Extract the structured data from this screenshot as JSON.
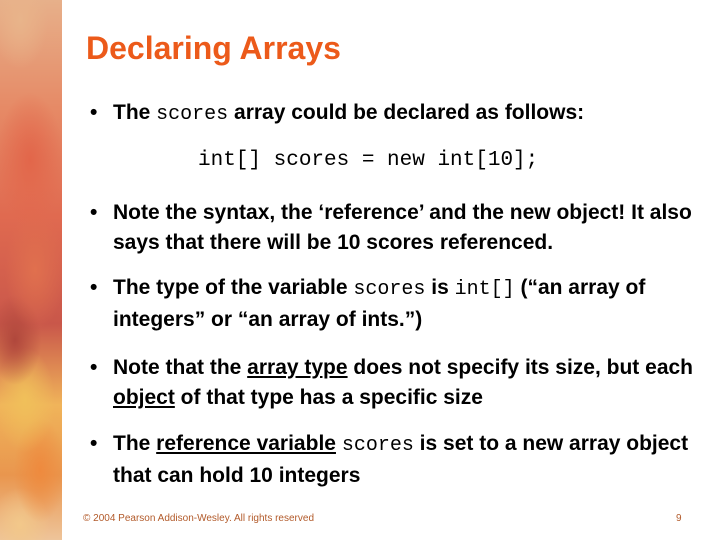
{
  "slide": {
    "title": "Declaring Arrays",
    "colors": {
      "title": "#ec5a1a",
      "footer": "#b25a2a",
      "text": "#000000"
    },
    "bullet_glyph": "•",
    "bullets": [
      {
        "parts": [
          "The ",
          "scores",
          " array could be declared as follows:"
        ]
      },
      {
        "parts": [
          "Note the syntax, the ‘reference’ and the new object! It also says that there will be 10 scores referenced."
        ]
      },
      {
        "parts": [
          "The type of the variable ",
          "scores",
          " is ",
          "int[]",
          " (“an array of integers” or “an array of ints.”)"
        ]
      },
      {
        "parts": [
          "Note that the ",
          "array type",
          " does not specify its size, but each ",
          "object",
          " of that type has a specific size"
        ]
      },
      {
        "parts": [
          "The ",
          "reference variable",
          " ",
          "scores",
          " is set to a new array object that can hold 10 integers"
        ]
      }
    ],
    "code_line": "int[] scores = new int[10];",
    "footer": "© 2004 Pearson Addison-Wesley. All rights reserved",
    "page_number": "9"
  }
}
